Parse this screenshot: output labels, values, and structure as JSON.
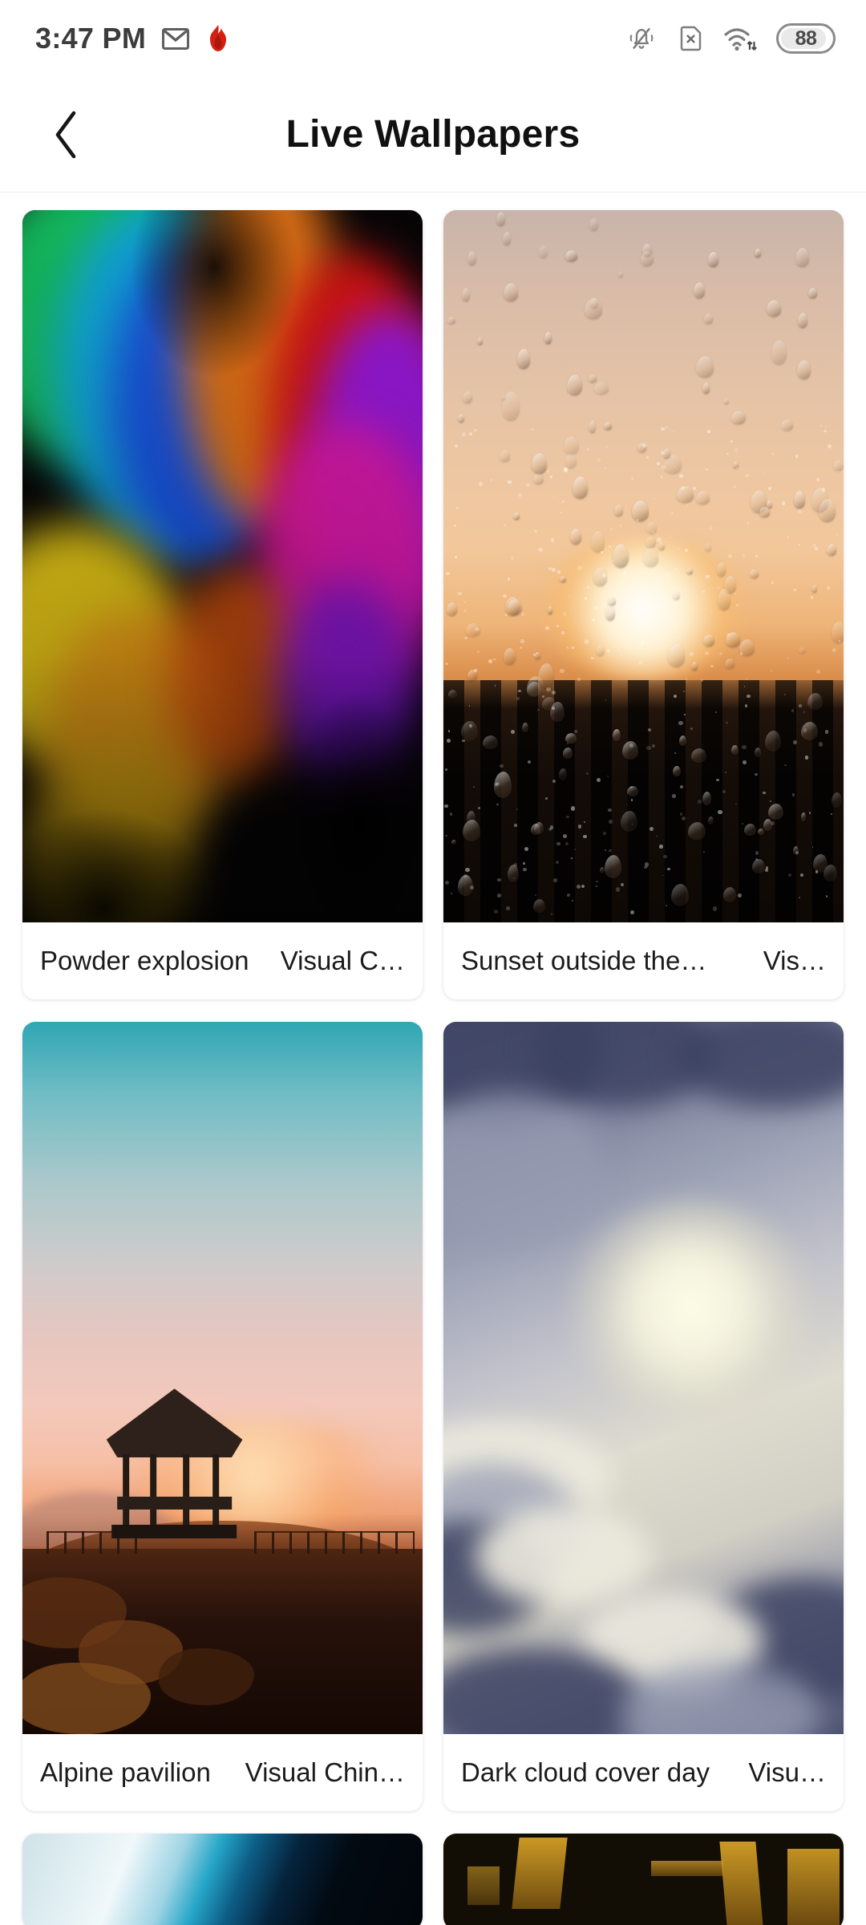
{
  "status_bar": {
    "time": "3:47 PM",
    "battery_level": "88",
    "icons": [
      "gmail-icon",
      "flame-icon",
      "silent-bell-icon",
      "no-sim-icon",
      "wifi-icon",
      "battery-icon"
    ]
  },
  "app_bar": {
    "back_label": "‹",
    "title": "Live Wallpapers"
  },
  "wallpapers": [
    {
      "title": "Powder explosion",
      "author": "Visual C…"
    },
    {
      "title": "Sunset outside the…",
      "author": "Vis…"
    },
    {
      "title": "Alpine pavilion",
      "author": "Visual Chin…"
    },
    {
      "title": "Dark cloud cover day",
      "author": "Visu…"
    }
  ],
  "colors": {
    "background": "#ffffff",
    "card_background": "#ffffff",
    "title_text": "#111111",
    "caption_text": "#1b1b1b",
    "status_text": "#3c3c3c",
    "divider": "#ececec",
    "flame_icon": "#d32011"
  }
}
